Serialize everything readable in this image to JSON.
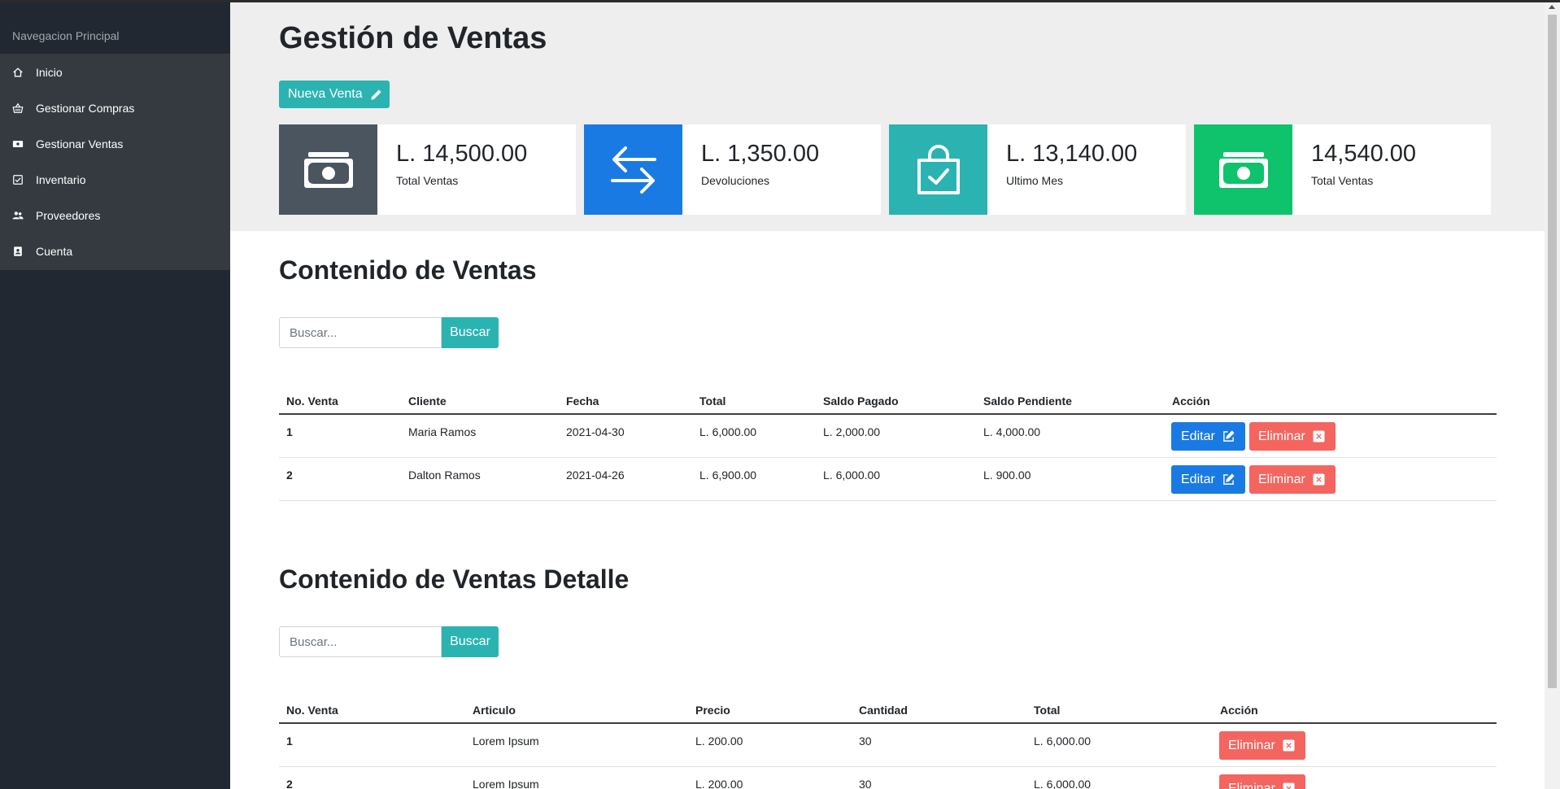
{
  "sidebar": {
    "title": "Navegacion Principal",
    "items": [
      {
        "label": "Inicio",
        "icon": "home-icon"
      },
      {
        "label": "Gestionar Compras",
        "icon": "basket-icon"
      },
      {
        "label": "Gestionar Ventas",
        "icon": "money-icon"
      },
      {
        "label": "Inventario",
        "icon": "checklist-icon"
      },
      {
        "label": "Proveedores",
        "icon": "users-icon"
      },
      {
        "label": "Cuenta",
        "icon": "contact-icon"
      }
    ]
  },
  "header": {
    "title": "Gestión de Ventas",
    "new_button": "Nueva Venta"
  },
  "stats": [
    {
      "value": "L. 14,500.00",
      "label": "Total Ventas",
      "icon": "cash-icon",
      "color": "#4a5560"
    },
    {
      "value": "L. 1,350.00",
      "label": "Devoluciones",
      "icon": "arrows-swap-icon",
      "color": "#1a7ae3"
    },
    {
      "value": "L. 13,140.00",
      "label": "Ultimo Mes",
      "icon": "shopping-bag-check-icon",
      "color": "#2ab3b1"
    },
    {
      "value": "14,540.00",
      "label": "Total Ventas",
      "icon": "cash-icon",
      "color": "#0ec36b"
    }
  ],
  "ventas": {
    "title": "Contenido de Ventas",
    "search_placeholder": "Buscar...",
    "search_button": "Buscar",
    "columns": [
      "No. Venta",
      "Cliente",
      "Fecha",
      "Total",
      "Saldo Pagado",
      "Saldo Pendiente",
      "Acción"
    ],
    "rows": [
      {
        "no": "1",
        "cliente": "Maria Ramos",
        "fecha": "2021-04-30",
        "total": "L. 6,000.00",
        "pagado": "L. 2,000.00",
        "pendiente": "L. 4,000.00"
      },
      {
        "no": "2",
        "cliente": "Dalton Ramos",
        "fecha": "2021-04-26",
        "total": "L. 6,900.00",
        "pagado": "L. 6,000.00",
        "pendiente": "L. 900.00"
      }
    ],
    "edit_label": "Editar",
    "delete_label": "Eliminar"
  },
  "detalle": {
    "title": "Contenido de Ventas Detalle",
    "search_placeholder": "Buscar...",
    "search_button": "Buscar",
    "columns": [
      "No. Venta",
      "Articulo",
      "Precio",
      "Cantidad",
      "Total",
      "Acción"
    ],
    "rows": [
      {
        "no": "1",
        "articulo": "Lorem Ipsum",
        "precio": "L. 200.00",
        "cantidad": "30",
        "total": "L. 6,000.00"
      },
      {
        "no": "2",
        "articulo": "Lorem Ipsum",
        "precio": "L. 200.00",
        "cantidad": "30",
        "total": "L. 6,000.00"
      }
    ],
    "delete_label": "Eliminar"
  },
  "colors": {
    "sidebar_bg": "#212831",
    "sidebar_panel": "#343a40",
    "teal": "#2ab3b1",
    "blue": "#1a7ae3",
    "red": "#f4655f",
    "green": "#0ec36b",
    "slate": "#4a5560"
  }
}
